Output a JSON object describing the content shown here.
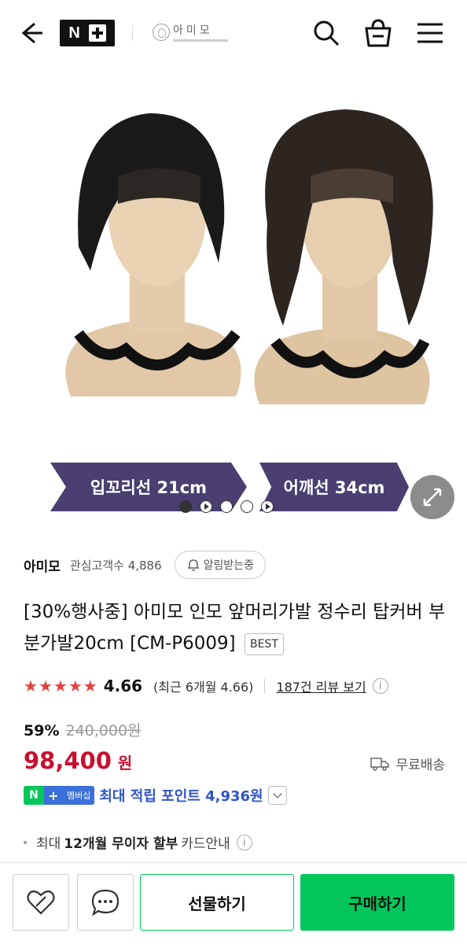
{
  "header": {
    "nplus_label": "N",
    "brand_logo_text": "아미모",
    "icons": [
      "back-arrow-icon",
      "search-icon",
      "shopping-bag-icon",
      "menu-icon"
    ]
  },
  "gallery": {
    "label_left": "입꼬리선 21cm",
    "label_right": "어깨선 34cm",
    "slide_count": 5,
    "active_slide": 0
  },
  "product": {
    "seller": "아미모",
    "fans_label": "관심고객수 4,886",
    "alarm_label": "알림받는중",
    "title": "[30%행사중] 아미모 인모 앞머리가발 정수리 탑커버 부분가발20cm [CM-P6009]",
    "best_badge": "BEST",
    "rating": "4.66",
    "rating_value": 4.66,
    "recent_rating": "(최근 6개월 4.66)",
    "reviews_link": "187건 리뷰 보기",
    "discount": "59%",
    "original_price": "240,000원",
    "price": "98,400",
    "currency": "원",
    "shipping": "무료배송",
    "membership_badge": "멤버십",
    "points": "최대 적립 포인트 4,936원",
    "card_prefix": "최대",
    "card_bold": "12개월 무이자 할부",
    "card_suffix": "카드안내"
  },
  "bottom_bar": {
    "gift_label": "선물하기",
    "buy_label": "구매하기"
  },
  "colors": {
    "green": "#03c75a",
    "price_red": "#c8102e",
    "point_blue": "#2f54c9",
    "label_purple": "#4a3f70"
  }
}
